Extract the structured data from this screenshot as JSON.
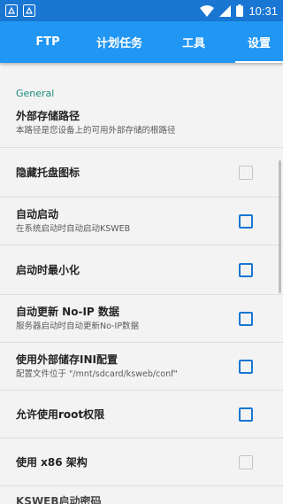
{
  "status_bar": {
    "time": "10:31",
    "icons": [
      "notification-icon",
      "notification-icon",
      "wifi-icon",
      "signal-icon",
      "battery-icon"
    ]
  },
  "tabs": [
    {
      "label": "FTP"
    },
    {
      "label": "计划任务"
    },
    {
      "label": "工具"
    },
    {
      "label": "设置"
    }
  ],
  "settings": {
    "section_title": "General",
    "items": [
      {
        "title": "外部存储路径",
        "summary": "本路径是您设备上的可用外部存储的根路径"
      },
      {
        "title": "隐藏托盘图标",
        "summary": ""
      },
      {
        "title": "自动启动",
        "summary": "在系统启动时自动启动KSWEB"
      },
      {
        "title": "启动时最小化",
        "summary": ""
      },
      {
        "title": "自动更新 No-IP 数据",
        "summary": "服务器启动时自动更新No-IP数据"
      },
      {
        "title": "使用外部储存INI配置",
        "summary": "配置文件位于 \"/mnt/sdcard/ksweb/conf\""
      },
      {
        "title": "允许使用root权限",
        "summary": ""
      },
      {
        "title": "使用 x86 架构",
        "summary": ""
      },
      {
        "title": "KSWEB启动密码",
        "summary": ""
      }
    ]
  },
  "colors": {
    "status_bar": "#1976d2",
    "tab_bar": "#2196f3",
    "section_header": "#1a8c7e",
    "checkbox": "#1976d2",
    "checkbox_disabled": "#c4c4c4"
  }
}
